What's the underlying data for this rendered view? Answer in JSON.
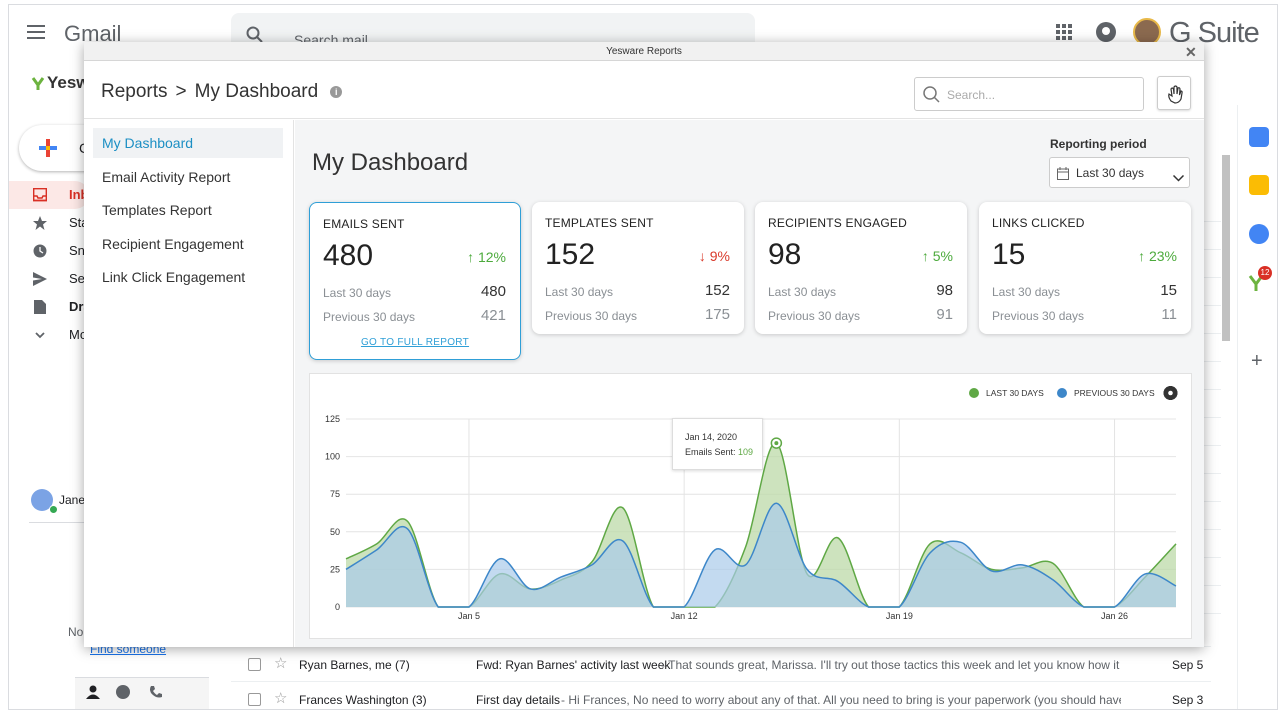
{
  "gmail": {
    "logo": "Gmail",
    "search_placeholder": "Search mail",
    "suite": "G Suite",
    "yesware_peek": "Yesw",
    "compose_peek": "Co",
    "nav": [
      {
        "icon": "inbox-icon",
        "label": "Inb"
      },
      {
        "icon": "star-icon",
        "label": "Sta"
      },
      {
        "icon": "clock-icon",
        "label": "Sn"
      },
      {
        "icon": "send-icon",
        "label": "Se"
      },
      {
        "icon": "file-icon",
        "label": "Dra"
      },
      {
        "icon": "chevron-down-icon",
        "label": "Mo"
      }
    ],
    "hangouts_user": "Jane",
    "no_text": "No",
    "find_someone": "Find someone",
    "emails": [
      {
        "sender": "Ryan Barnes, me (7)",
        "subject": "Fwd: Ryan Barnes' activity last week",
        "snippet": "That sounds great, Marissa. I'll try out those tactics this week and let you know how it goe",
        "date": "Sep 5"
      },
      {
        "sender": "Frances Washington (3)",
        "subject": "First day details",
        "snippet": "Hi Frances, No need to worry about any of that. All you need to bring is your paperwork (you should have rece",
        "date": "Sep 3"
      }
    ],
    "badge_count": "12"
  },
  "modal": {
    "window_title": "Yesware Reports",
    "breadcrumb_root": "Reports",
    "breadcrumb_sep": ">",
    "breadcrumb_page": "My Dashboard",
    "search_placeholder": "Search...",
    "sidebar": [
      "My Dashboard",
      "Email Activity Report",
      "Templates Report",
      "Recipient Engagement",
      "Link Click Engagement"
    ],
    "page_title": "My Dashboard",
    "reporting_label": "Reporting period",
    "reporting_value": "Last 30 days",
    "cards": [
      {
        "title": "EMAILS SENT",
        "value": "480",
        "delta": "↑ 12%",
        "dir": "up",
        "l1": "Last 30 days",
        "v1": "480",
        "l2": "Previous 30 days",
        "v2": "421",
        "link": "GO TO FULL REPORT"
      },
      {
        "title": "TEMPLATES SENT",
        "value": "152",
        "delta": "↓ 9%",
        "dir": "down",
        "l1": "Last 30 days",
        "v1": "152",
        "l2": "Previous 30 days",
        "v2": "175"
      },
      {
        "title": "RECIPIENTS ENGAGED",
        "value": "98",
        "delta": "↑ 5%",
        "dir": "up",
        "l1": "Last 30 days",
        "v1": "98",
        "l2": "Previous 30 days",
        "v2": "91"
      },
      {
        "title": "LINKS CLICKED",
        "value": "15",
        "delta": "↑ 23%",
        "dir": "up",
        "l1": "Last 30 days",
        "v1": "15",
        "l2": "Previous 30 days",
        "v2": "11"
      }
    ],
    "tooltip": {
      "date": "Jan 14, 2020",
      "label": "Emails Sent:",
      "value": "109"
    }
  },
  "chart_data": {
    "type": "area",
    "ylim": [
      0,
      125
    ],
    "yticks": [
      0,
      25,
      50,
      75,
      100,
      125
    ],
    "xticks": [
      {
        "day": 5,
        "label": "Jan 5"
      },
      {
        "day": 12,
        "label": "Jan 12"
      },
      {
        "day": 19,
        "label": "Jan 19"
      },
      {
        "day": 26,
        "label": "Jan 26"
      }
    ],
    "x": [
      1,
      2,
      3,
      4,
      5,
      6,
      7,
      8,
      9,
      10,
      11,
      12,
      13,
      14,
      15,
      16,
      17,
      18,
      19,
      20,
      21,
      22,
      23,
      24,
      25,
      26,
      27,
      28
    ],
    "series": [
      {
        "name": "LAST 30 DAYS",
        "color": "#5fa845",
        "fill": "#bcd9a8",
        "values": [
          32,
          42,
          57,
          0,
          0,
          22,
          12,
          18,
          30,
          66,
          0,
          0,
          0,
          40,
          109,
          22,
          46,
          0,
          0,
          42,
          36,
          25,
          26,
          29,
          0,
          0,
          20,
          42
        ]
      },
      {
        "name": "PREVIOUS 30 DAYS",
        "color": "#3d87c9",
        "fill": "#a9cbe9",
        "values": [
          25,
          38,
          52,
          0,
          0,
          32,
          12,
          20,
          28,
          44,
          0,
          0,
          38,
          28,
          69,
          25,
          17,
          0,
          0,
          36,
          43,
          24,
          28,
          18,
          0,
          0,
          22,
          14
        ]
      }
    ]
  },
  "colors": {
    "accent": "#1c8fc4",
    "green": "#4caa3c",
    "red": "#d93a2b"
  }
}
